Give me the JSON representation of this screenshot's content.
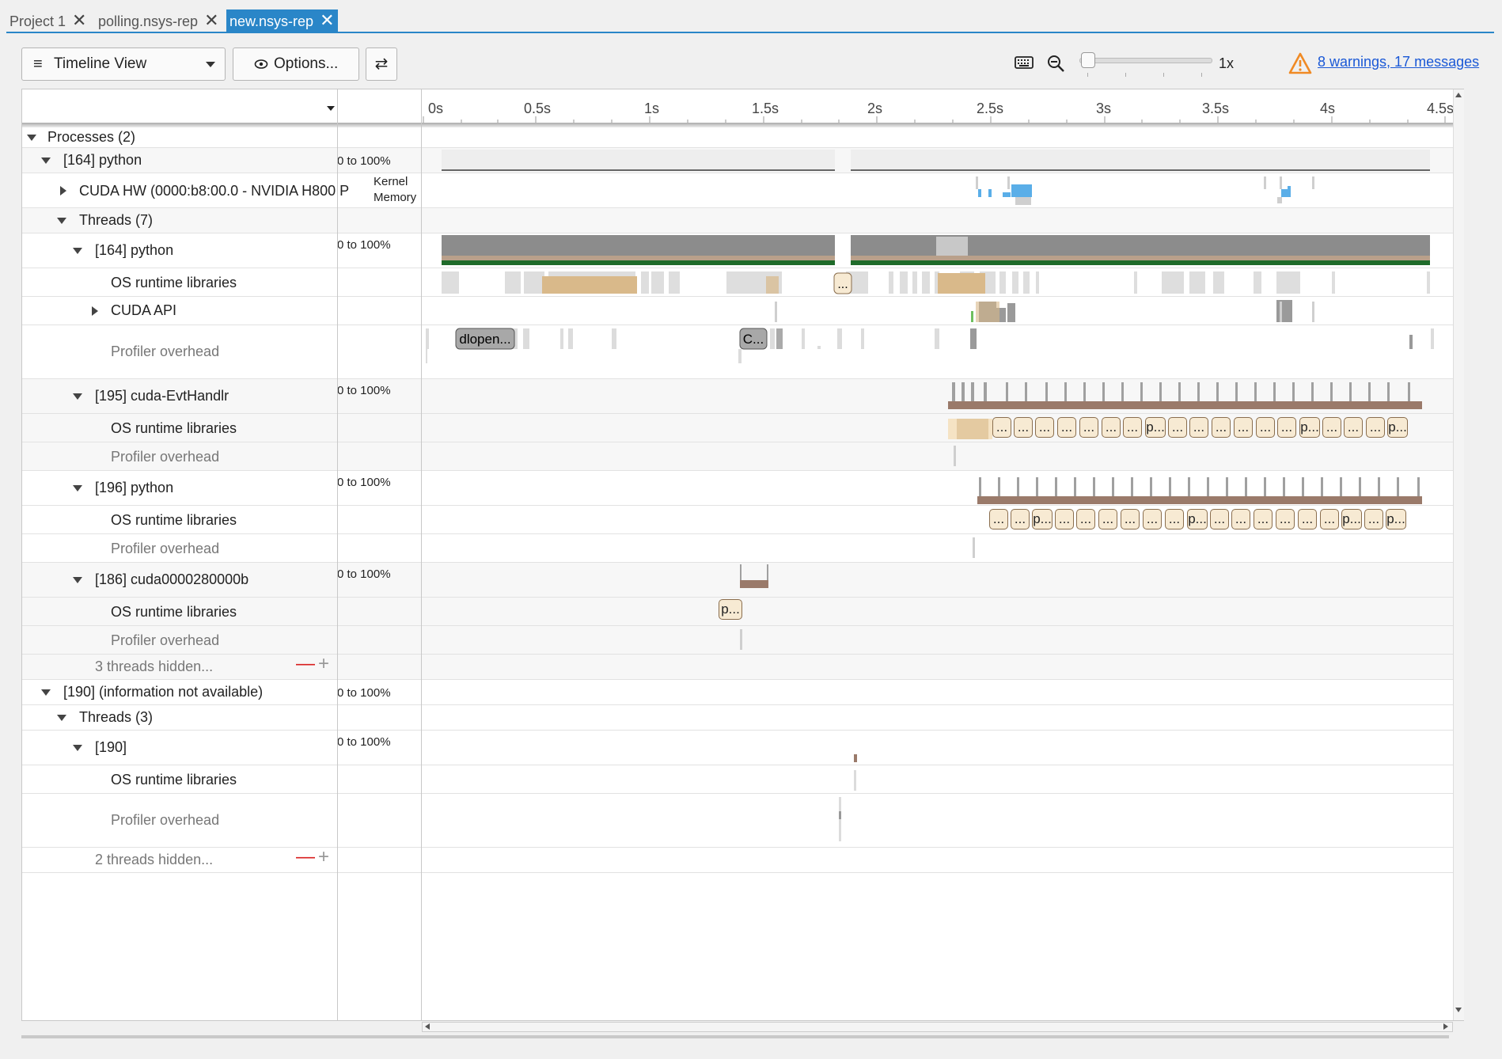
{
  "tabs": [
    {
      "label": "Project 1"
    },
    {
      "label": "polling.nsys-rep"
    },
    {
      "label": "new.nsys-rep"
    }
  ],
  "toolbar": {
    "view_label": "Timeline View",
    "options_label": "Options...",
    "zoom_label": "1x",
    "warnings_label": "8 warnings, 17 messages"
  },
  "ruler": {
    "ticks": [
      "0s",
      "0.5s",
      "1s",
      "1.5s",
      "2s",
      "2.5s",
      "3s",
      "3.5s",
      "4s",
      "4.5s"
    ]
  },
  "tree": {
    "processes": "Processes (2)",
    "p164": "[164] python",
    "cuda_hw": "CUDA HW (0000:b8:00.0 - NVIDIA H800 P",
    "threads7": "Threads (7)",
    "t164": "[164] python",
    "os_rt": "OS runtime libraries",
    "cuda_api": "CUDA API",
    "prof": "Profiler overhead",
    "t195": "[195] cuda-EvtHandlr",
    "t196": "[196] python",
    "t186": "[186] cuda0000280000b",
    "hidden3": "3 threads hidden...",
    "p190": "[190] (information not available)",
    "threads3": "Threads (3)",
    "t190": "[190]",
    "hidden2": "2 threads hidden..."
  },
  "scale": {
    "range": "0 to 100%",
    "kernel": "Kernel",
    "memory": "Memory"
  },
  "events": {
    "ellipsis": "...",
    "dlopen": "dlopen...",
    "c": "C...",
    "p": "p..."
  },
  "colors": {
    "accent": "#2a86c8",
    "cpu_grey": "#8c8c8c",
    "thread_green": "#1f6b2a",
    "os_rt_tan": "#d9b98a",
    "kernel_blue": "#5aaee8",
    "warning": "#f08a24"
  },
  "icons": [
    "close-icon",
    "menu-icon",
    "dropdown-icon",
    "eye-icon",
    "swap-icon",
    "keyboard-icon",
    "zoom-out-icon",
    "warning-icon",
    "expand-icon",
    "collapse-icon",
    "minus-icon",
    "plus-icon"
  ]
}
